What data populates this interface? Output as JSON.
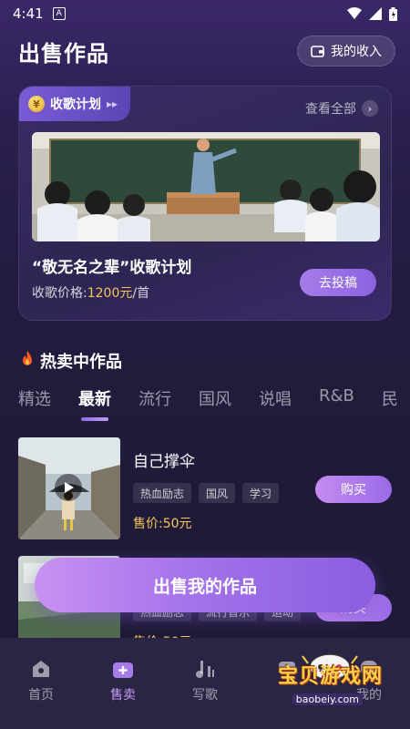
{
  "status_bar": {
    "time": "4:41",
    "badge": "A"
  },
  "header": {
    "title": "出售作品",
    "income_label": "我的收入"
  },
  "plan": {
    "tag": "收歌计划",
    "view_all": "查看全部",
    "name": "“敬无名之辈”收歌计划",
    "price_label": "收歌价格:",
    "price_value": "1200元",
    "price_unit": "/首",
    "submit_label": "去投稿"
  },
  "hot": {
    "title": "热卖中作品",
    "tabs": [
      "精选",
      "最新",
      "流行",
      "国风",
      "说唱",
      "R&B",
      "民"
    ],
    "active_tab": 1
  },
  "songs": [
    {
      "title": "自己撑伞",
      "tags": [
        "热血励志",
        "国风",
        "学习"
      ],
      "price": "售价:50元",
      "buy_label": "购买"
    },
    {
      "title": "",
      "tags": [
        "热血励志",
        "流行音乐",
        "运动"
      ],
      "price": "售价:50元",
      "buy_label": "购买"
    }
  ],
  "sell_button": "出售我的作品",
  "nav": [
    {
      "label": "首页",
      "icon": "home-icon"
    },
    {
      "label": "售卖",
      "icon": "sell-icon",
      "active": true
    },
    {
      "label": "写歌",
      "icon": "music-note-icon"
    },
    {
      "label": "",
      "icon": "message-icon"
    },
    {
      "label": "我的",
      "icon": "profile-icon"
    }
  ],
  "watermark": {
    "text": "宝贝游戏网",
    "url": "baobeiy.com"
  },
  "colors": {
    "accent": "#a57ce8",
    "price": "#f5c65a",
    "background": "#221b3e"
  }
}
